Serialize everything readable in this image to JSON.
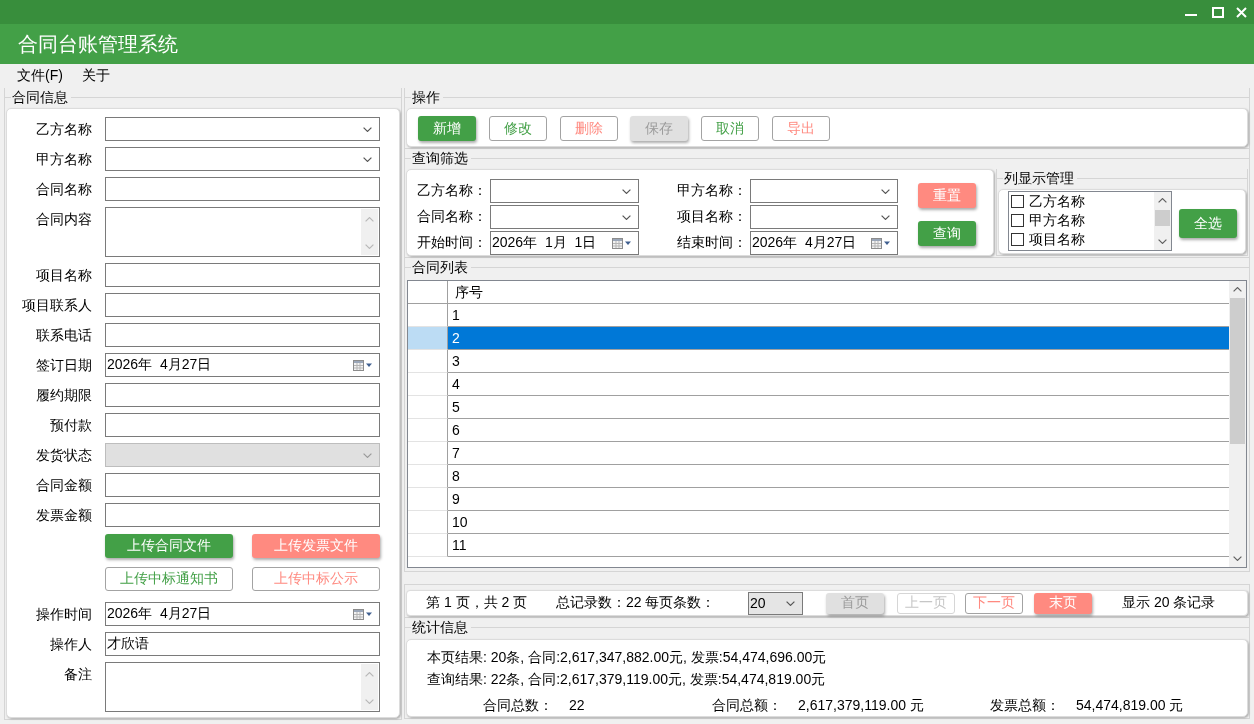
{
  "window": {
    "title": "合同台账管理系统"
  },
  "menu": [
    "文件(F)",
    "关于"
  ],
  "contract_info": {
    "title": "合同信息",
    "fields": [
      {
        "label": "乙方名称",
        "kind": "combo",
        "disabled": false
      },
      {
        "label": "甲方名称",
        "kind": "combo",
        "disabled": false
      },
      {
        "label": "合同名称",
        "kind": "text",
        "disabled": false
      },
      {
        "label": "合同内容",
        "kind": "textarea",
        "disabled": false
      },
      {
        "label": "项目名称",
        "kind": "text",
        "disabled": false
      },
      {
        "label": "项目联系人",
        "kind": "text",
        "disabled": false
      },
      {
        "label": "联系电话",
        "kind": "text",
        "disabled": false
      },
      {
        "label": "签订日期",
        "kind": "date",
        "value": "2026年  4月27日",
        "disabled": false
      },
      {
        "label": "履约期限",
        "kind": "text",
        "disabled": false
      },
      {
        "label": "预付款",
        "kind": "text",
        "disabled": false
      },
      {
        "label": "发货状态",
        "kind": "combo",
        "disabled": true
      },
      {
        "label": "合同金额",
        "kind": "text",
        "disabled": false
      },
      {
        "label": "发票金额",
        "kind": "text",
        "disabled": false
      }
    ],
    "upload_buttons": [
      {
        "label": "上传合同文件",
        "kind": "filled",
        "color": "#43a047"
      },
      {
        "label": "上传发票文件",
        "kind": "filled",
        "color": "#ff8a80"
      },
      {
        "label": "上传中标通知书",
        "kind": "outline",
        "color": "#43a047"
      },
      {
        "label": "上传中标公示",
        "kind": "outline",
        "color": "#ff8a80"
      }
    ],
    "more_fields": [
      {
        "label": "操作时间",
        "kind": "date",
        "value": "2026年  4月27日",
        "disabled": false
      },
      {
        "label": "操作人",
        "kind": "text",
        "value": "才欣语",
        "disabled": false
      },
      {
        "label": "备注",
        "kind": "textarea",
        "disabled": false
      }
    ]
  },
  "toolbar": {
    "title": "操作",
    "buttons": [
      {
        "label": "新增",
        "kind": "filled",
        "color": "#43a047",
        "disabled": false
      },
      {
        "label": "修改",
        "kind": "outline",
        "color": "#43a047",
        "disabled": false
      },
      {
        "label": "删除",
        "kind": "outline",
        "color": "#ff8a80",
        "disabled": false
      },
      {
        "label": "保存",
        "kind": "filled",
        "disabled": true
      },
      {
        "label": "取消",
        "kind": "outline",
        "color": "#43a047",
        "disabled": false
      },
      {
        "label": "导出",
        "kind": "outline",
        "color": "#ff8a80",
        "disabled": false
      }
    ]
  },
  "filter": {
    "title": "查询筛选",
    "fields": [
      {
        "label": "乙方名称：",
        "kind": "combo"
      },
      {
        "label": "甲方名称：",
        "kind": "combo"
      },
      {
        "label": "合同名称：",
        "kind": "combo"
      },
      {
        "label": "项目名称：",
        "kind": "combo"
      },
      {
        "label": "开始时间：",
        "kind": "date",
        "value": "2026年  1月  1日"
      },
      {
        "label": "结束时间：",
        "kind": "date",
        "value": "2026年  4月27日"
      }
    ],
    "buttons": [
      {
        "label": "重置",
        "kind": "filled",
        "color": "#ff8a80"
      },
      {
        "label": "查询",
        "kind": "filled",
        "color": "#43a047"
      }
    ],
    "column_manager": {
      "title": "列显示管理",
      "items": [
        {
          "label": "乙方名称",
          "checked": false
        },
        {
          "label": "甲方名称",
          "checked": false
        },
        {
          "label": "项目名称",
          "checked": false
        }
      ],
      "button": {
        "label": "全选",
        "kind": "filled",
        "color": "#43a047"
      }
    }
  },
  "table": {
    "title": "合同列表",
    "columns": [
      "序号"
    ],
    "rows": [
      {
        "cells": [
          "1"
        ],
        "selected": false
      },
      {
        "cells": [
          "2"
        ],
        "selected": true
      },
      {
        "cells": [
          "3"
        ],
        "selected": false
      },
      {
        "cells": [
          "4"
        ],
        "selected": false
      },
      {
        "cells": [
          "5"
        ],
        "selected": false
      },
      {
        "cells": [
          "6"
        ],
        "selected": false
      },
      {
        "cells": [
          "7"
        ],
        "selected": false
      },
      {
        "cells": [
          "8"
        ],
        "selected": false
      },
      {
        "cells": [
          "9"
        ],
        "selected": false
      },
      {
        "cells": [
          "10"
        ],
        "selected": false
      },
      {
        "cells": [
          "11"
        ],
        "selected": false
      }
    ]
  },
  "pagination": {
    "page_info": "第 1 页，共 2 页",
    "record_info": "总记录数：22 每页条数：",
    "page_size": "20",
    "buttons": [
      {
        "label": "首页",
        "kind": "filled",
        "disabled": true
      },
      {
        "label": "上一页",
        "kind": "outline",
        "disabled": true
      },
      {
        "label": "下一页",
        "kind": "outline",
        "color": "#ff8a80",
        "disabled": false
      },
      {
        "label": "末页",
        "kind": "filled",
        "color": "#ff8a80",
        "disabled": false
      }
    ],
    "display_info": "显示 20 条记录"
  },
  "statistics": {
    "title": "统计信息",
    "lines": [
      "本页结果: 20条, 合同:2,617,347,882.00元, 发票:54,474,696.00元",
      "查询结果: 22条, 合同:2,617,379,119.00元, 发票:54,474,819.00元"
    ],
    "totals": [
      {
        "label": "合同总数：",
        "value": "22"
      },
      {
        "label": "合同总额：",
        "value": "2,617,379,119.00 元"
      },
      {
        "label": "发票总额：",
        "value": "54,474,819.00 元"
      }
    ]
  }
}
